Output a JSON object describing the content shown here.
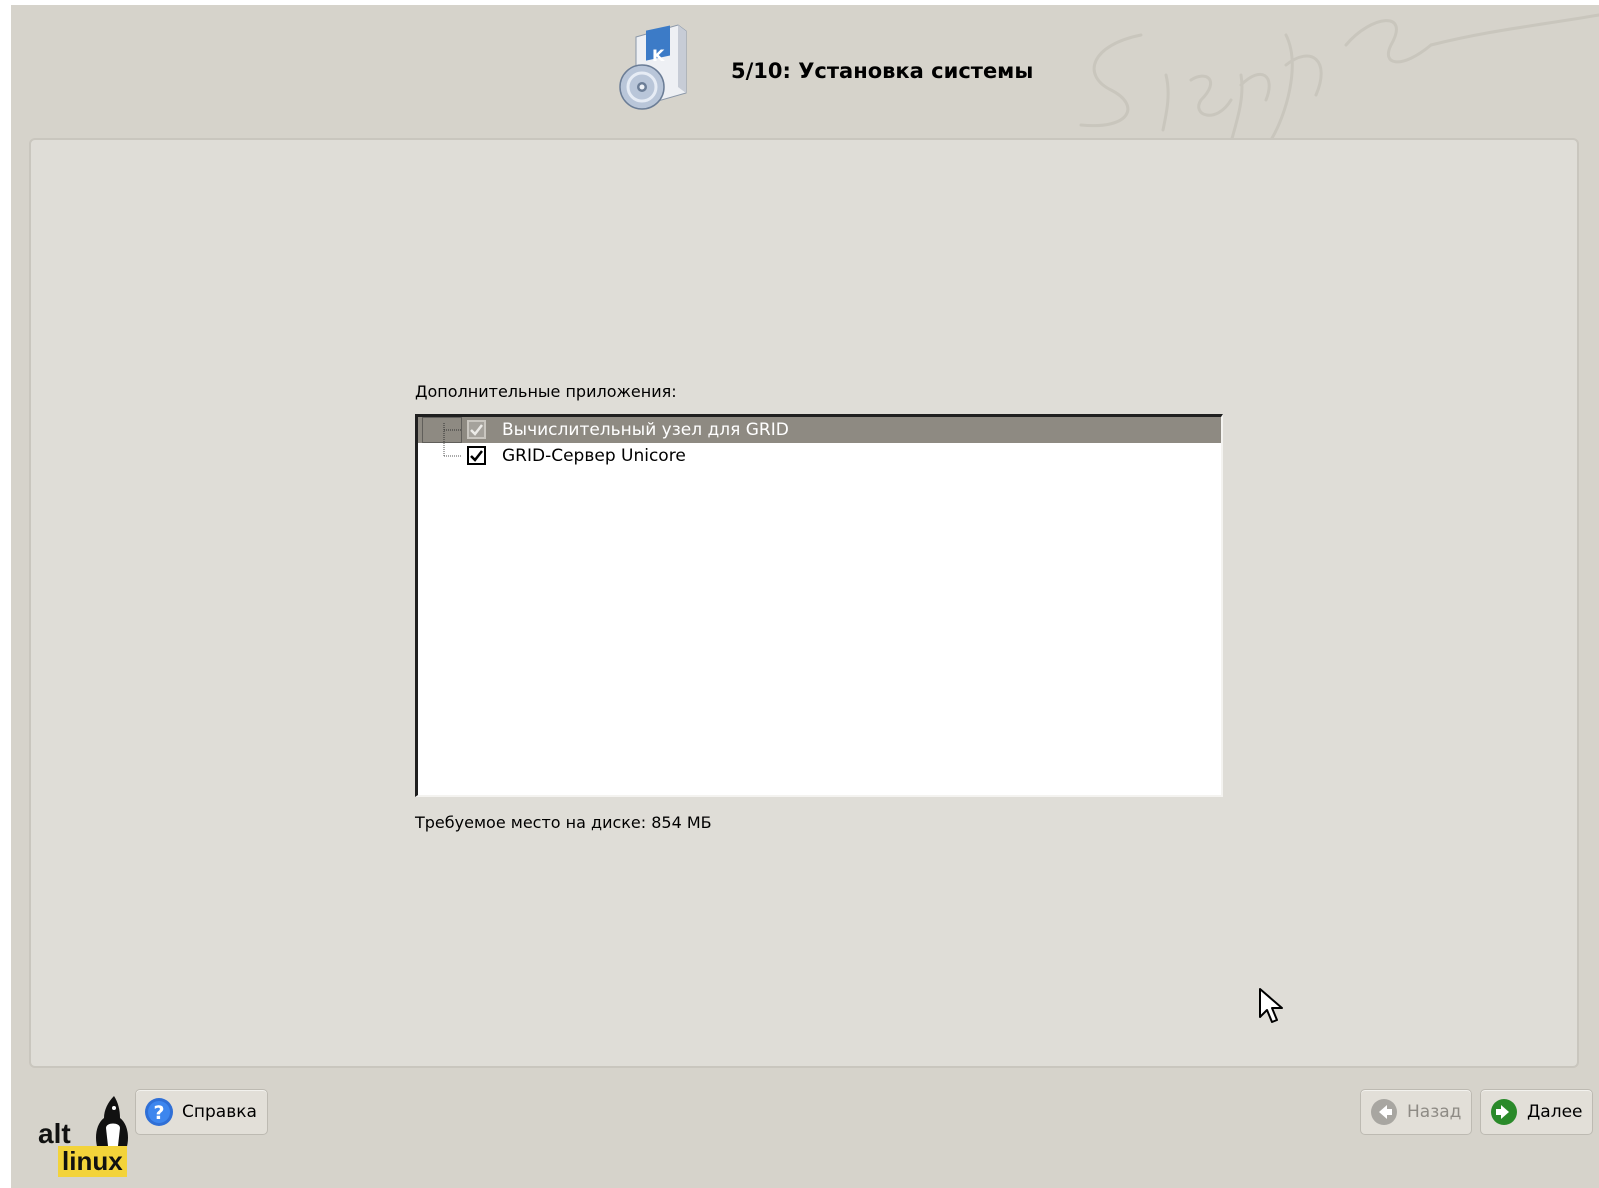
{
  "header": {
    "title": "5/10: Установка системы"
  },
  "main": {
    "section_label": "Дополнительные приложения:",
    "items": [
      {
        "label": "Вычислительный узел для GRID",
        "checked": true,
        "selected": true
      },
      {
        "label": "GRID-Сервер Unicore",
        "checked": true,
        "selected": false
      }
    ],
    "disk_required": "Требуемое место на диске: 854 МБ"
  },
  "footer": {
    "logo_text_top": "alt",
    "logo_text_bottom": "linux",
    "help_label": "Справка",
    "back_label": "Назад",
    "next_label": "Далее"
  },
  "colors": {
    "background": "#d6d3cb",
    "panel": "#dfddd7",
    "selection": "#8e8a82",
    "help_icon": "#2f6fd6",
    "next_icon": "#2a8a2a",
    "logo_yellow": "#f3d33a"
  },
  "icons": {
    "header": "installer-package-cd-icon",
    "help": "question-circle-icon",
    "back": "arrow-left-circle-icon",
    "next": "arrow-right-circle-icon",
    "cursor": "mouse-pointer-icon"
  }
}
